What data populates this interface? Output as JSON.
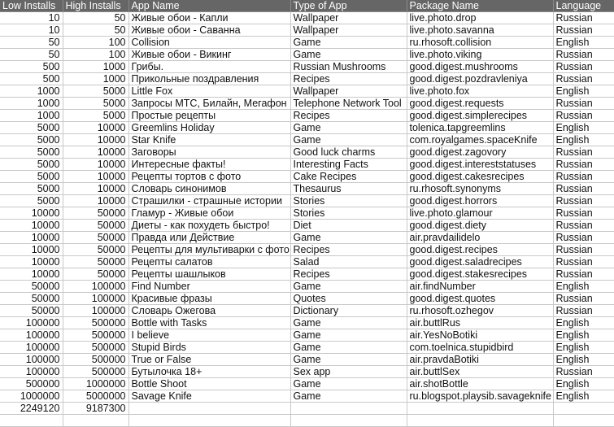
{
  "columns": [
    "Low Installs",
    "High Installs",
    "App Name",
    "Type of App",
    "Package Name",
    "Language"
  ],
  "rows": [
    {
      "low": "10",
      "high": "50",
      "name": "Живые обои - Капли",
      "type": "Wallpaper",
      "package": "live.photo.drop",
      "language": "Russian"
    },
    {
      "low": "10",
      "high": "50",
      "name": "Живые обои - Саванна",
      "type": "Wallpaper",
      "package": "live.photo.savanna",
      "language": "Russian"
    },
    {
      "low": "50",
      "high": "100",
      "name": "Collision",
      "type": "Game",
      "package": "ru.rhosoft.collision",
      "language": "English"
    },
    {
      "low": "50",
      "high": "100",
      "name": "Живые обои - Викинг",
      "type": "Game",
      "package": "live.photo.viking",
      "language": "Russian"
    },
    {
      "low": "500",
      "high": "1000",
      "name": "Грибы.",
      "type": "Russian Mushrooms",
      "package": "good.digest.mushrooms",
      "language": "Russian"
    },
    {
      "low": "500",
      "high": "1000",
      "name": "Прикольные поздравления",
      "type": "Recipes",
      "package": "good.digest.pozdravleniya",
      "language": "Russian"
    },
    {
      "low": "1000",
      "high": "5000",
      "name": "Little Fox",
      "type": "Wallpaper",
      "package": "live.photo.fox",
      "language": "English"
    },
    {
      "low": "1000",
      "high": "5000",
      "name": "Запросы МТС, Билайн, Мегафон",
      "type": "Telephone Network Tool",
      "package": "good.digest.requests",
      "language": "Russian"
    },
    {
      "low": "1000",
      "high": "5000",
      "name": "Простые рецепты",
      "type": "Recipes",
      "package": "good.digest.simplerecipes",
      "language": "Russian"
    },
    {
      "low": "5000",
      "high": "10000",
      "name": "Greemlins Holiday",
      "type": "Game",
      "package": "tolenica.tapgreemlins",
      "language": "English"
    },
    {
      "low": "5000",
      "high": "10000",
      "name": "Star Knife",
      "type": "Game",
      "package": "com.royalgames.spaceKnife",
      "language": "English"
    },
    {
      "low": "5000",
      "high": "10000",
      "name": "Заговоры",
      "type": "Good luck charms",
      "package": "good.digest.zagovory",
      "language": "Russian"
    },
    {
      "low": "5000",
      "high": "10000",
      "name": "Интересные факты!",
      "type": "Interesting Facts",
      "package": "good.digest.intereststatuses",
      "language": "Russian"
    },
    {
      "low": "5000",
      "high": "10000",
      "name": "Рецепты тортов с фото",
      "type": "Cake Recipes",
      "package": "good.digest.cakesrecipes",
      "language": "Russian"
    },
    {
      "low": "5000",
      "high": "10000",
      "name": "Словарь синонимов",
      "type": "Thesaurus",
      "package": "ru.rhosoft.synonyms",
      "language": "Russian"
    },
    {
      "low": "5000",
      "high": "10000",
      "name": "Страшилки - страшные истории",
      "type": "Stories",
      "package": "good.digest.horrors",
      "language": "Russian"
    },
    {
      "low": "10000",
      "high": "50000",
      "name": "Гламур - Живые обои",
      "type": "Stories",
      "package": "live.photo.glamour",
      "language": "Russian"
    },
    {
      "low": "10000",
      "high": "50000",
      "name": "Диеты - как похудеть быстро!",
      "type": "Diet",
      "package": "good.digest.diety",
      "language": "Russian"
    },
    {
      "low": "10000",
      "high": "50000",
      "name": "Правда или Действие",
      "type": "Game",
      "package": "air.pravdailidelo",
      "language": "Russian"
    },
    {
      "low": "10000",
      "high": "50000",
      "name": "Рецепты для мультиварки с фото",
      "type": "Recipes",
      "package": "good.digest.recipes",
      "language": "Russian"
    },
    {
      "low": "10000",
      "high": "50000",
      "name": "Рецепты салатов",
      "type": "Salad",
      "package": "good.digest.saladrecipes",
      "language": "Russian"
    },
    {
      "low": "10000",
      "high": "50000",
      "name": "Рецепты шашлыков",
      "type": "Recipes",
      "package": "good.digest.stakesrecipes",
      "language": "Russian"
    },
    {
      "low": "50000",
      "high": "100000",
      "name": "Find Number",
      "type": "Game",
      "package": "air.findNumber",
      "language": "English"
    },
    {
      "low": "50000",
      "high": "100000",
      "name": "Красивые фразы",
      "type": "Quotes",
      "package": "good.digest.quotes",
      "language": "Russian"
    },
    {
      "low": "50000",
      "high": "100000",
      "name": "Словарь Ожегова",
      "type": "Dictionary",
      "package": "ru.rhosoft.ozhegov",
      "language": "Russian"
    },
    {
      "low": "100000",
      "high": "500000",
      "name": "Bottle with Tasks",
      "type": "Game",
      "package": "air.buttlRus",
      "language": "English"
    },
    {
      "low": "100000",
      "high": "500000",
      "name": "I believe",
      "type": "Game",
      "package": "air.YesNoBotiki",
      "language": "English"
    },
    {
      "low": "100000",
      "high": "500000",
      "name": "Stupid Birds",
      "type": "Game",
      "package": "com.toelnica.stupidbird",
      "language": "English"
    },
    {
      "low": "100000",
      "high": "500000",
      "name": "True or False",
      "type": "Game",
      "package": "air.pravdaBotiki",
      "language": "English"
    },
    {
      "low": "100000",
      "high": "500000",
      "name": "Бутылочка 18+",
      "type": "Sex app",
      "package": "air.buttlSex",
      "language": "Russian"
    },
    {
      "low": "500000",
      "high": "1000000",
      "name": "Bottle Shoot",
      "type": "Game",
      "package": "air.shotBottle",
      "language": "English"
    },
    {
      "low": "1000000",
      "high": "5000000",
      "name": "Savage Knife",
      "type": "Game",
      "package": "ru.blogspot.playsib.savageknife",
      "language": "English"
    }
  ],
  "totals": {
    "low": "2249120",
    "high": "9187300"
  }
}
